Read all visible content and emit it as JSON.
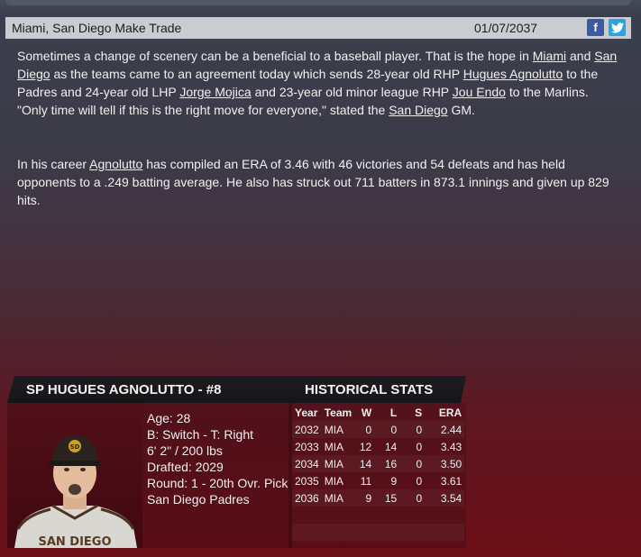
{
  "header": {
    "title": "Miami, San Diego Make Trade",
    "date": "01/07/2037",
    "facebook_glyph": "f",
    "twitter_glyph": "t"
  },
  "article": {
    "p1": [
      {
        "t": "Sometimes a change of scenery can be a beneficial to a baseball player. That is the hope in "
      },
      {
        "t": "Miami",
        "link": true
      },
      {
        "t": " and "
      },
      {
        "t": "San Diego",
        "link": true
      },
      {
        "t": " as the teams came to an agreement today which sends 28-year old RHP "
      },
      {
        "t": "Hugues Agnolutto",
        "link": true
      },
      {
        "t": " to the Padres and 24-year old LHP "
      },
      {
        "t": "Jorge Mojica",
        "link": true
      },
      {
        "t": " and 23-year old minor league RHP "
      },
      {
        "t": "Jou Endo",
        "link": true
      },
      {
        "t": " to the Marlins. \"Only time will tell if this is the right move for everyone,\" stated the "
      },
      {
        "t": "San Diego",
        "link": true
      },
      {
        "t": " GM."
      }
    ],
    "p2": [
      {
        "t": "In his career "
      },
      {
        "t": "Agnolutto",
        "link": true
      },
      {
        "t": " has compiled an ERA of 3.46 with 46 victories and 54 defeats and has held opponents to a .249 batting average. He also has struck out 711 batters in 873.1 innings and given up 829 hits."
      }
    ]
  },
  "player": {
    "heading": "SP HUGUES AGNOLUTTO - #8",
    "age": "Age: 28",
    "bats_throws": "B: Switch - T: Right",
    "height_weight": "6' 2\" / 200 lbs",
    "drafted": "Drafted: 2029",
    "round": "Round: 1 - 20th Ovr. Pick",
    "team": "San Diego Padres",
    "cap_logo": "SD",
    "jersey_text": "SAN DIEGO"
  },
  "stats": {
    "heading": "HISTORICAL STATS",
    "columns": [
      "Year",
      "Team",
      "W",
      "L",
      "S",
      "ERA"
    ],
    "rows": [
      [
        "2032",
        "MIA",
        "0",
        "0",
        "0",
        "2.44"
      ],
      [
        "2033",
        "MIA",
        "12",
        "14",
        "0",
        "3.43"
      ],
      [
        "2034",
        "MIA",
        "14",
        "16",
        "0",
        "3.50"
      ],
      [
        "2035",
        "MIA",
        "11",
        "9",
        "0",
        "3.61"
      ],
      [
        "2036",
        "MIA",
        "9",
        "15",
        "0",
        "3.54"
      ]
    ]
  }
}
